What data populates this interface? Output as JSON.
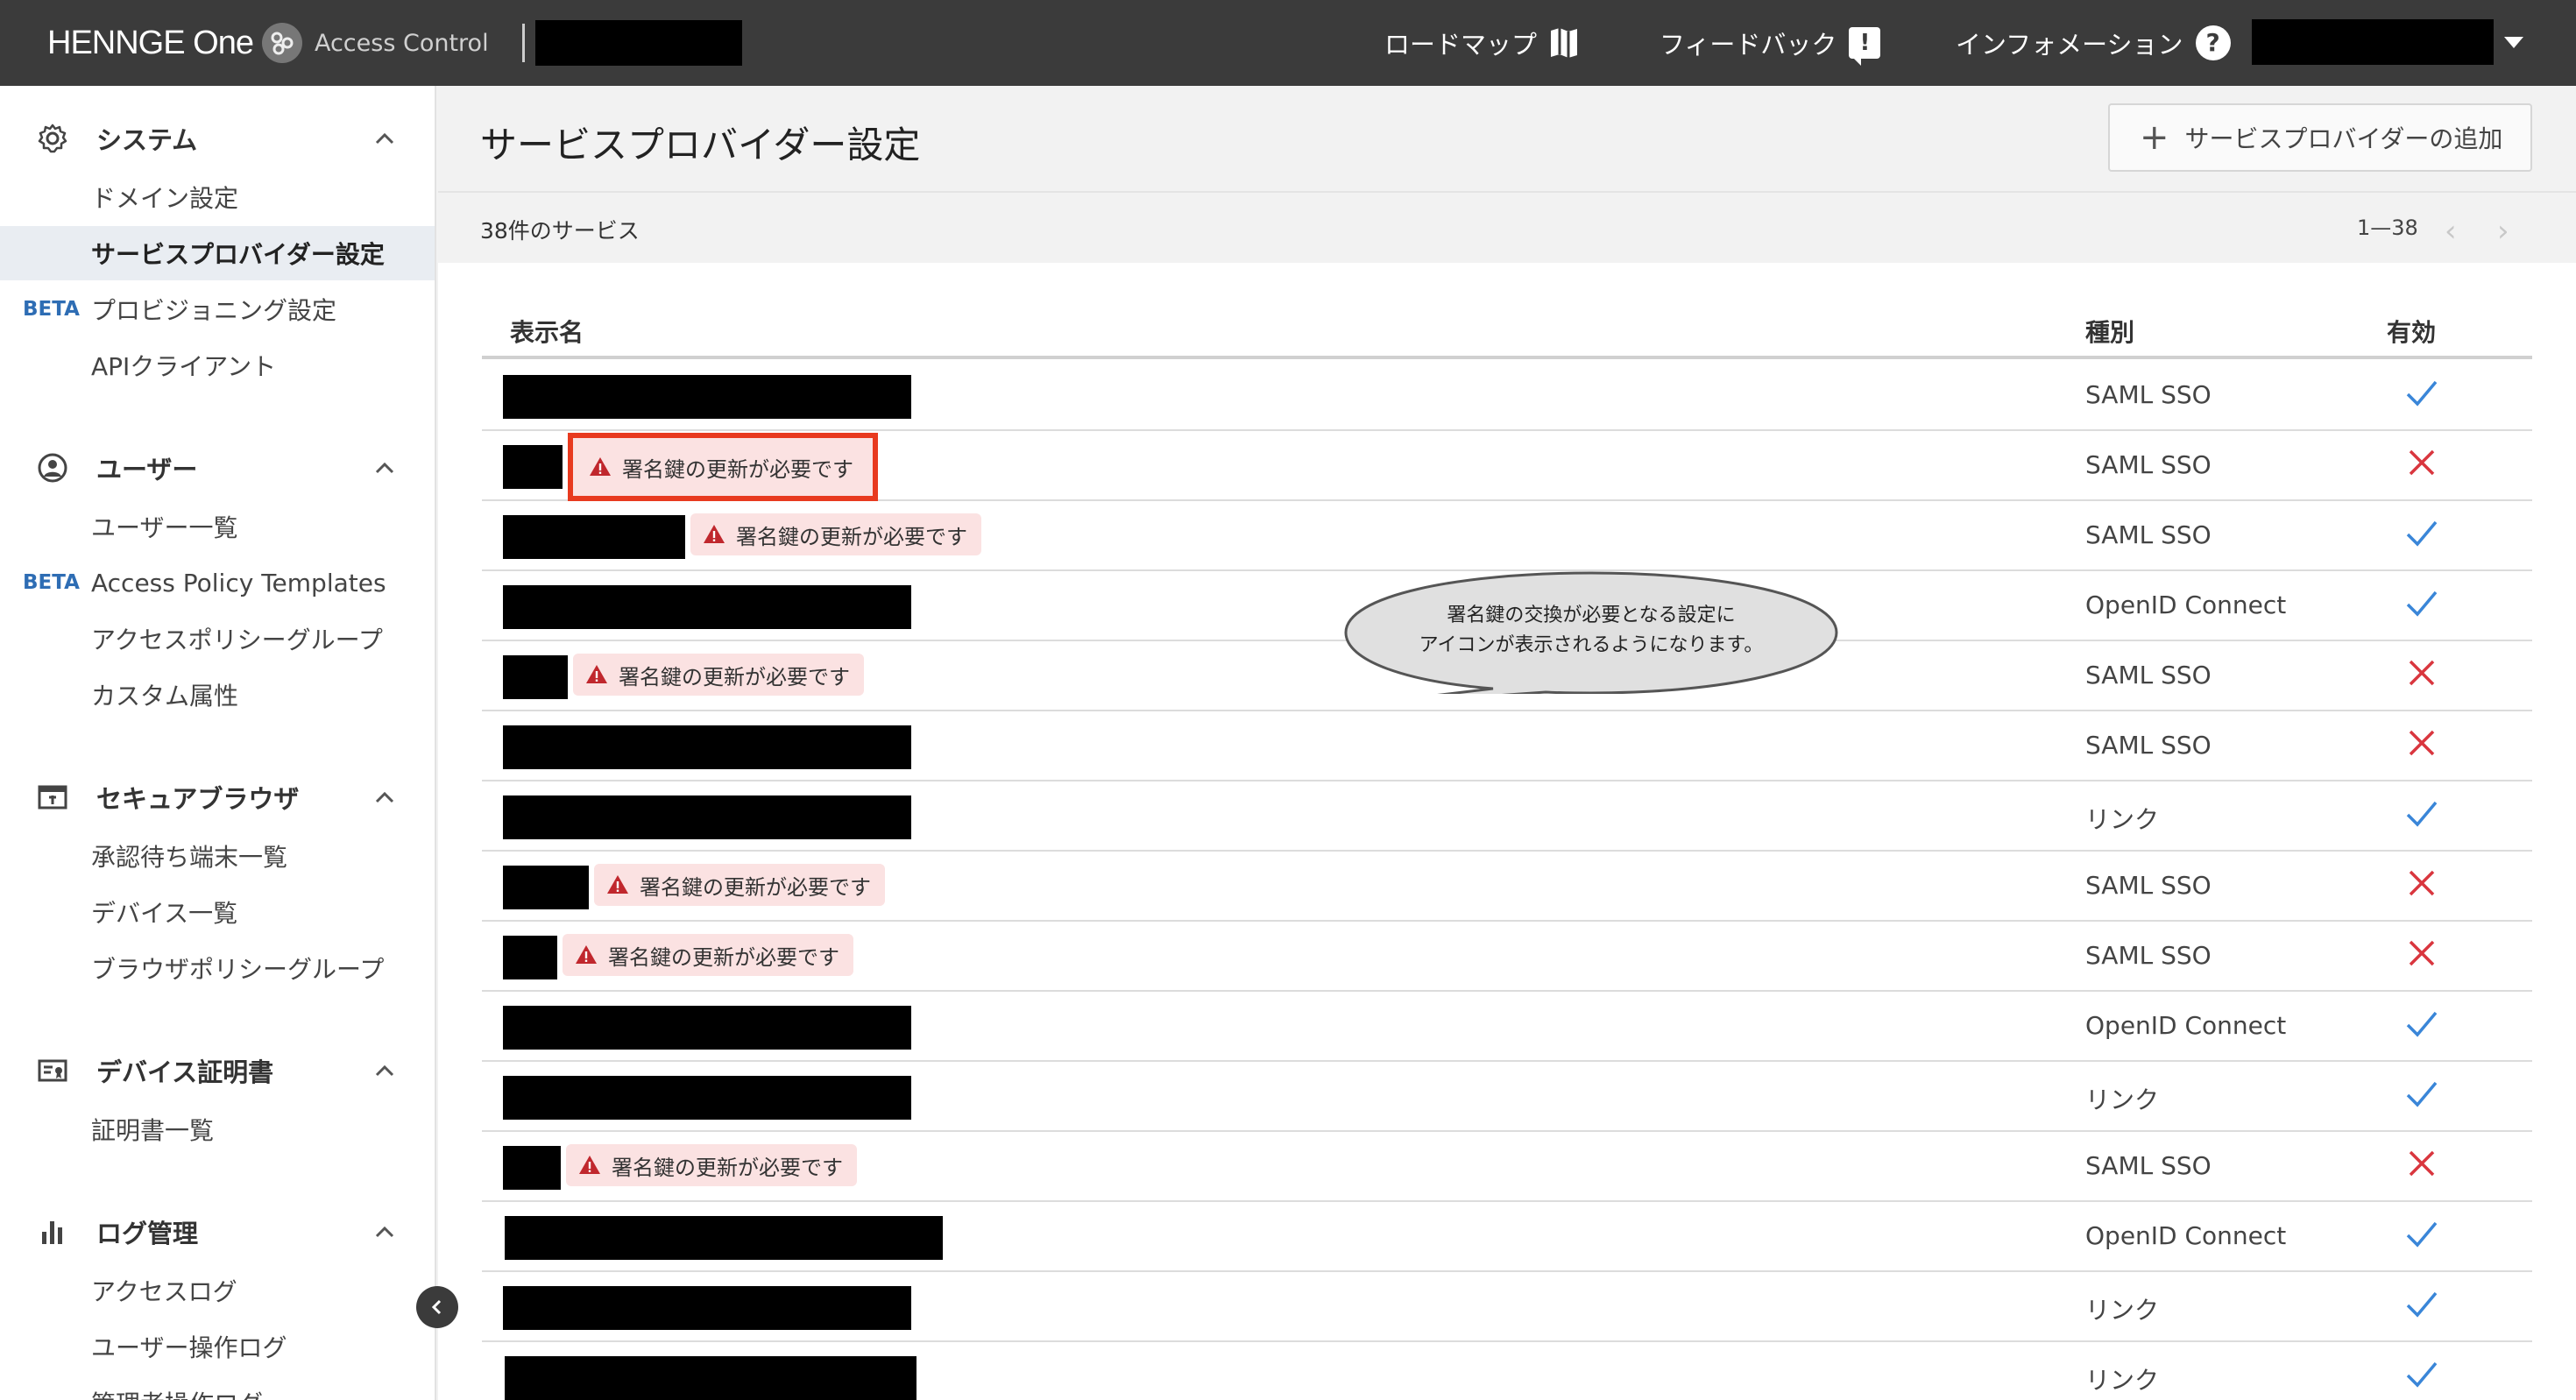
{
  "header": {
    "brand": "HENNGE One",
    "product": "Access Control",
    "nav": [
      {
        "label": "ロードマップ",
        "icon": "map-icon"
      },
      {
        "label": "フィードバック",
        "icon": "feedback-icon"
      },
      {
        "label": "インフォメーション",
        "icon": "question-icon"
      }
    ]
  },
  "sidebar": {
    "sections": [
      {
        "title": "システム",
        "icon": "gear-icon",
        "items": [
          {
            "label": "ドメイン設定"
          },
          {
            "label": "サービスプロバイダー設定",
            "active": true
          },
          {
            "label": "プロビジョニング設定",
            "badge": "BETA"
          },
          {
            "label": "APIクライアント"
          }
        ]
      },
      {
        "title": "ユーザー",
        "icon": "user-icon",
        "items": [
          {
            "label": "ユーザー一覧"
          },
          {
            "label": "Access Policy Templates",
            "badge": "BETA"
          },
          {
            "label": "アクセスポリシーグループ"
          },
          {
            "label": "カスタム属性"
          }
        ]
      },
      {
        "title": "セキュアブラウザ",
        "icon": "browser-icon",
        "items": [
          {
            "label": "承認待ち端末一覧"
          },
          {
            "label": "デバイス一覧"
          },
          {
            "label": "ブラウザポリシーグループ"
          }
        ]
      },
      {
        "title": "デバイス証明書",
        "icon": "certificate-icon",
        "items": [
          {
            "label": "証明書一覧"
          }
        ]
      },
      {
        "title": "ログ管理",
        "icon": "bar-chart-icon",
        "items": [
          {
            "label": "アクセスログ"
          },
          {
            "label": "ユーザー操作ログ"
          },
          {
            "label": "管理者操作ログ"
          }
        ]
      }
    ]
  },
  "main": {
    "title": "サービスプロバイダー設定",
    "add_button": "サービスプロバイダーの追加",
    "count_text": "38件のサービス",
    "range": "1—38",
    "columns": {
      "name": "表示名",
      "type": "種別",
      "enabled": "有効"
    },
    "warning_text": "署名鍵の更新が必要です",
    "callout_lines": [
      "署名鍵の交換が必要となる設定に",
      "アイコンが表示されるようになります。"
    ],
    "rows": [
      {
        "warn": false,
        "type": "SAML SSO",
        "enabled": true
      },
      {
        "warn": true,
        "highlight": true,
        "type": "SAML SSO",
        "enabled": false
      },
      {
        "warn": true,
        "type": "SAML SSO",
        "enabled": true
      },
      {
        "warn": false,
        "type": "OpenID Connect",
        "enabled": true
      },
      {
        "warn": true,
        "type": "SAML SSO",
        "enabled": false
      },
      {
        "warn": false,
        "type": "SAML SSO",
        "enabled": false
      },
      {
        "warn": false,
        "type": "リンク",
        "enabled": true
      },
      {
        "warn": true,
        "type": "SAML SSO",
        "enabled": false
      },
      {
        "warn": true,
        "type": "SAML SSO",
        "enabled": false
      },
      {
        "warn": false,
        "type": "OpenID Connect",
        "enabled": true
      },
      {
        "warn": false,
        "type": "リンク",
        "enabled": true
      },
      {
        "warn": true,
        "type": "SAML SSO",
        "enabled": false
      },
      {
        "warn": false,
        "type": "OpenID Connect",
        "enabled": true
      },
      {
        "warn": false,
        "type": "リンク",
        "enabled": true
      },
      {
        "warn": false,
        "type": "リンク",
        "enabled": true
      }
    ]
  },
  "colors": {
    "topbar": "#3b3b3b",
    "check": "#3a86d8",
    "cross": "#d9363e",
    "warn_bg": "#fbe2e2",
    "warn_icon": "#c0272d",
    "highlight": "#e83a1f",
    "beta": "#2e6db4"
  }
}
